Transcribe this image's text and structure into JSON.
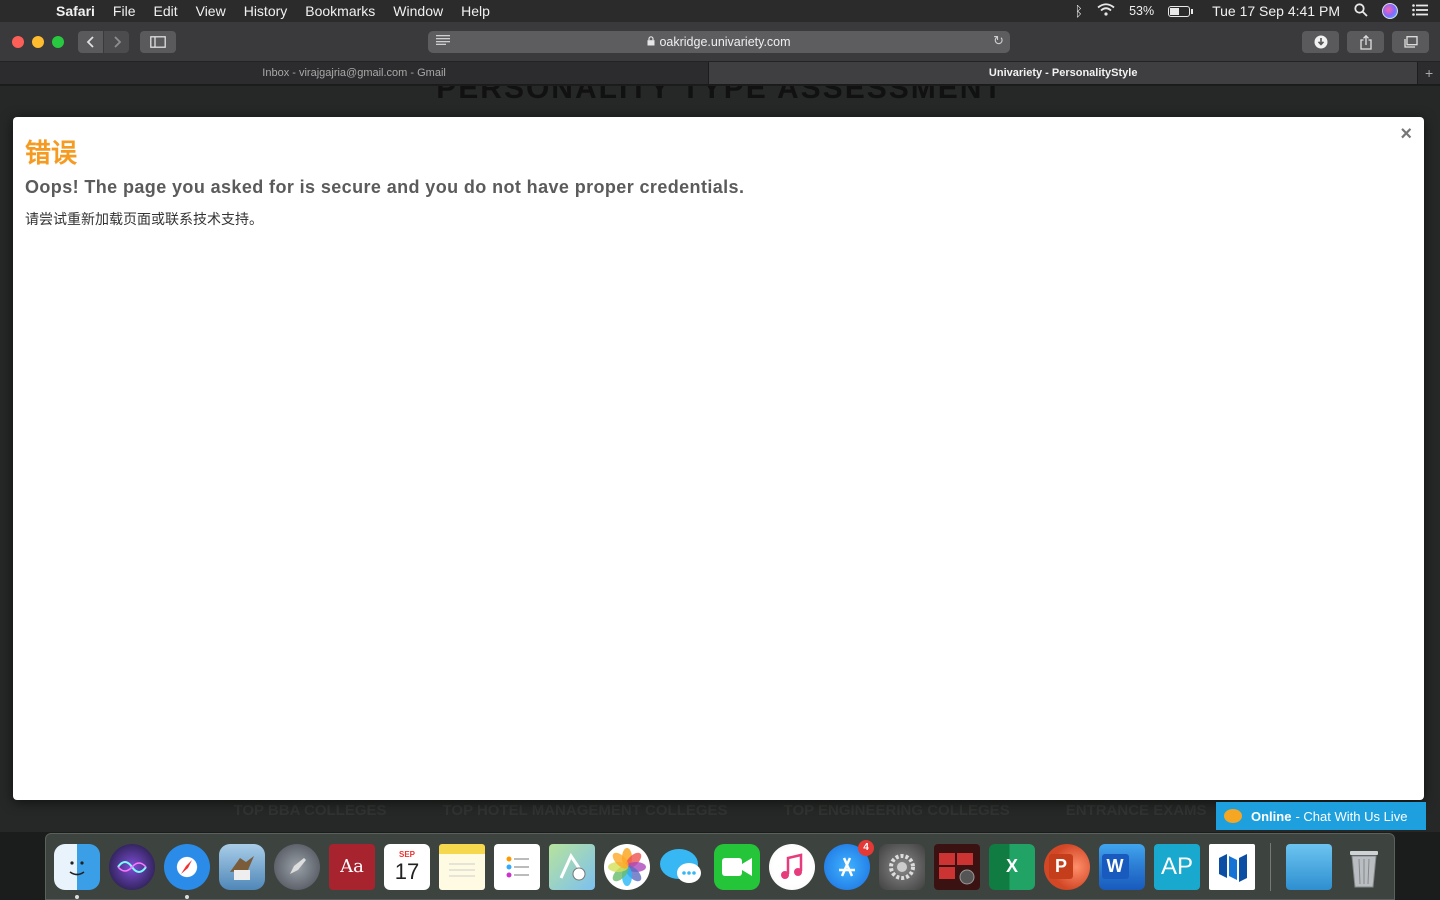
{
  "menubar": {
    "app": "Safari",
    "items": [
      "File",
      "Edit",
      "View",
      "History",
      "Bookmarks",
      "Window",
      "Help"
    ],
    "battery": "53%",
    "datetime": "Tue 17 Sep  4:41 PM"
  },
  "toolbar": {
    "url": "oakridge.univariety.com"
  },
  "tabs": [
    {
      "label": "Inbox - virajgajria@gmail.com - Gmail"
    },
    {
      "label": "Univariety - PersonalityStyle"
    }
  ],
  "page": {
    "background_heading": "PERSONALITY TYPE ASSESSMENT",
    "footer_links": [
      "TOP BBA COLLEGES",
      "TOP HOTEL MANAGEMENT COLLEGES",
      "TOP ENGINEERING COLLEGES",
      "ENTRANCE EXAMS"
    ]
  },
  "modal": {
    "close": "×",
    "title": "错误",
    "message": "Oops! The page you asked for is secure and you do not have proper credentials.",
    "sub": "请尝试重新加载页面或联系技术支持。"
  },
  "chat": {
    "status": "Online",
    "label": "- Chat With Us Live"
  },
  "dock": {
    "calendar_month": "SEP",
    "calendar_day": "17",
    "appstore_badge": "4",
    "excel": "X",
    "powerpoint": "P",
    "word": "W",
    "ap": "AP"
  },
  "colors": {
    "accent_title": "#f59b22",
    "chat_bg": "#1ea0df"
  }
}
